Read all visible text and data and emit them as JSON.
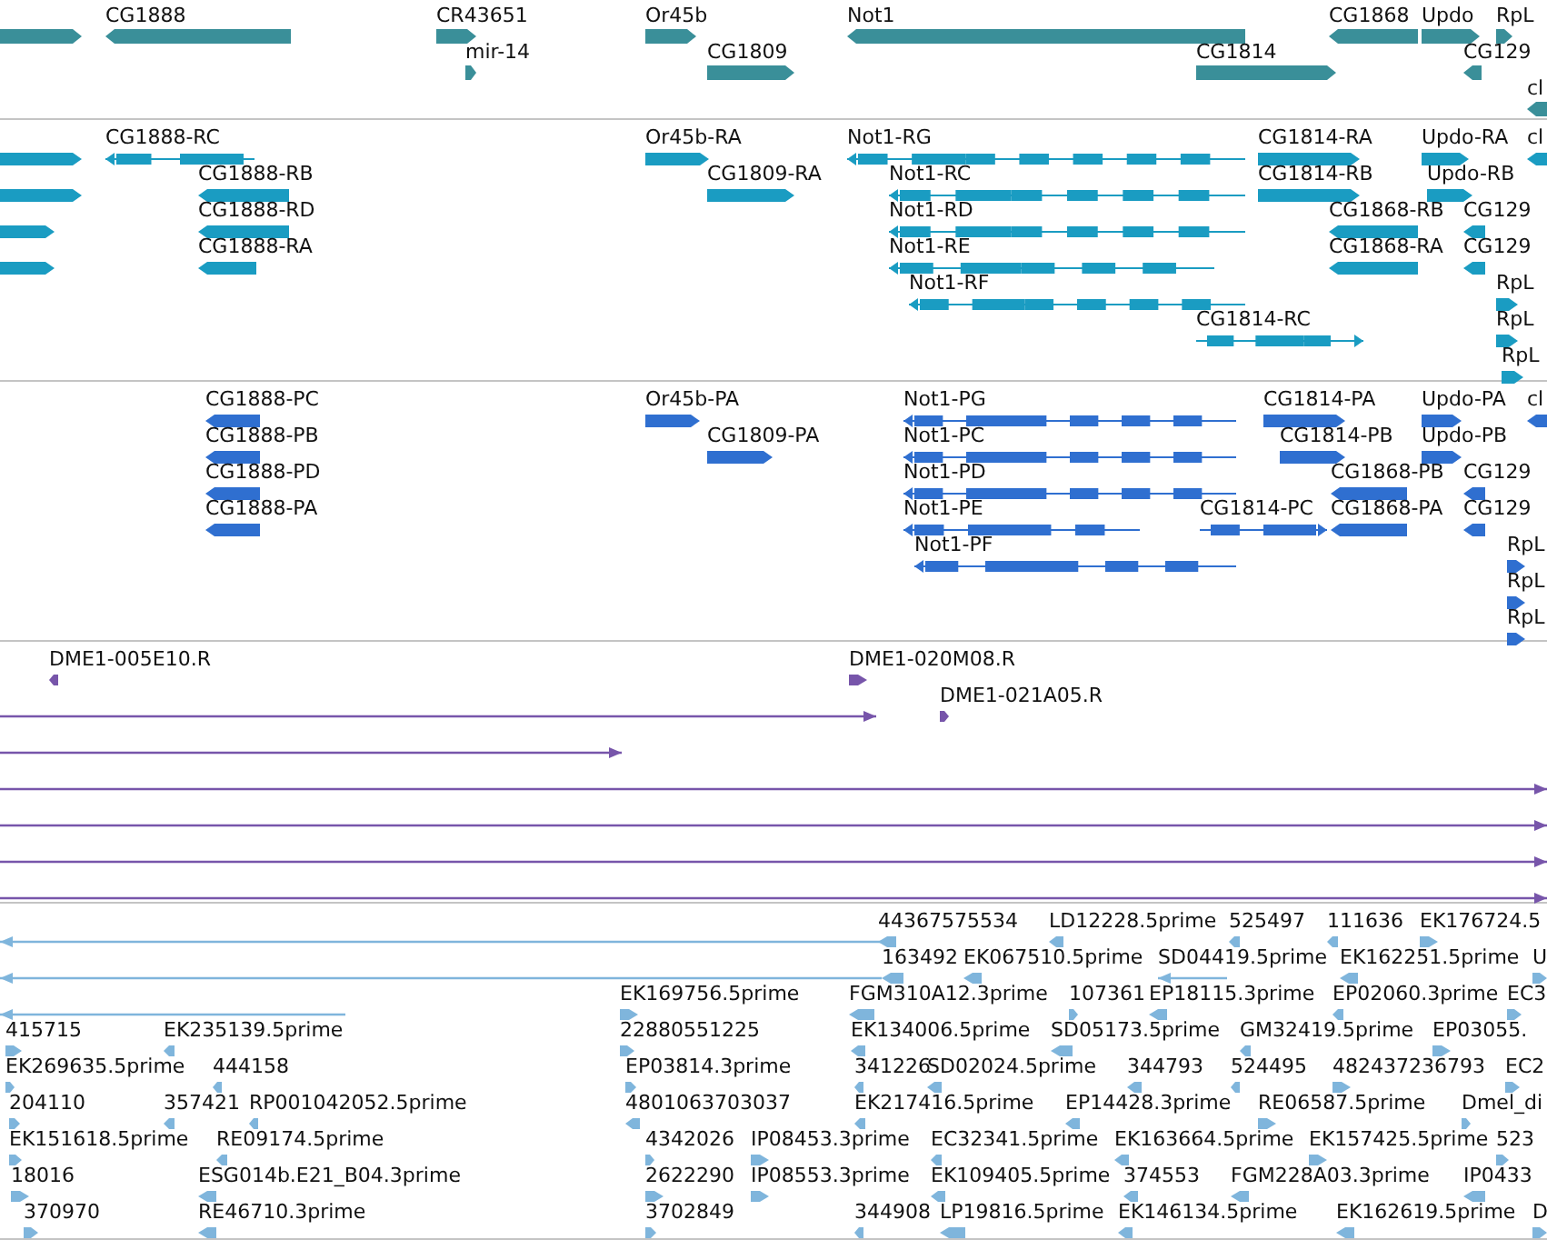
{
  "tracks": [
    {
      "kind": "gene",
      "color": "#3a8f99",
      "features": [
        {
          "reverse": false
        },
        {
          "label": "CG1888",
          "reverse": true
        },
        {
          "label": "CR43651",
          "reverse": false
        },
        {
          "label": "mir-14",
          "reverse": false
        },
        {
          "label": "Or45b",
          "reverse": false
        },
        {
          "label": "CG1809",
          "reverse": false
        },
        {
          "label": "Not1",
          "reverse": true
        },
        {
          "label": "CG1814",
          "reverse": false
        },
        {
          "label": "CG1868",
          "reverse": true
        },
        {
          "label": "Updo",
          "reverse": false
        },
        {
          "label": "RpL",
          "reverse": false
        },
        {
          "label": "CG129",
          "reverse": true
        },
        {
          "label": "cl",
          "reverse": true
        }
      ]
    },
    {
      "kind": "transcript",
      "color": "#1a9cc2",
      "features": [
        {
          "reverse": false
        },
        {
          "reverse": false
        },
        {
          "reverse": false
        },
        {
          "reverse": false
        },
        {
          "label": "CG1888-RC",
          "reverse": true
        },
        {
          "label": "CG1888-RB",
          "reverse": true
        },
        {
          "label": "CG1888-RD",
          "reverse": true
        },
        {
          "label": "CG1888-RA",
          "reverse": true
        },
        {
          "label": "Or45b-RA",
          "reverse": false
        },
        {
          "label": "CG1809-RA",
          "reverse": false
        },
        {
          "label": "Not1-RG",
          "reverse": true
        },
        {
          "label": "Not1-RC",
          "reverse": true
        },
        {
          "label": "Not1-RD",
          "reverse": true
        },
        {
          "label": "Not1-RE",
          "reverse": true
        },
        {
          "label": "Not1-RF",
          "reverse": true
        },
        {
          "label": "CG1814-RA",
          "reverse": false
        },
        {
          "label": "CG1814-RB",
          "reverse": false
        },
        {
          "label": "CG1868-RB",
          "reverse": true
        },
        {
          "label": "CG1868-RA",
          "reverse": true
        },
        {
          "label": "CG1814-RC",
          "reverse": false
        },
        {
          "label": "Updo-RA",
          "reverse": false
        },
        {
          "label": "Updo-RB",
          "reverse": false
        },
        {
          "label": "cl",
          "reverse": true
        },
        {
          "label": "CG129",
          "reverse": true
        },
        {
          "label": "CG129",
          "reverse": true
        },
        {
          "label": "RpL",
          "reverse": false
        },
        {
          "label": "RpL",
          "reverse": false
        },
        {
          "label": "RpL",
          "reverse": false
        }
      ]
    },
    {
      "kind": "protein",
      "color": "#2f6fd0",
      "features": [
        {
          "label": "CG1888-PC",
          "reverse": true
        },
        {
          "label": "CG1888-PB",
          "reverse": true
        },
        {
          "label": "CG1888-PD",
          "reverse": true
        },
        {
          "label": "CG1888-PA",
          "reverse": true
        },
        {
          "label": "Or45b-PA",
          "reverse": false
        },
        {
          "label": "CG1809-PA",
          "reverse": false
        },
        {
          "label": "Not1-PG",
          "reverse": true
        },
        {
          "label": "Not1-PC",
          "reverse": true
        },
        {
          "label": "Not1-PD",
          "reverse": true
        },
        {
          "label": "Not1-PE",
          "reverse": true
        },
        {
          "label": "Not1-PF",
          "reverse": true
        },
        {
          "label": "CG1814-PA",
          "reverse": false
        },
        {
          "label": "CG1814-PB",
          "reverse": false
        },
        {
          "label": "CG1868-PB",
          "reverse": true
        },
        {
          "label": "CG1814-PC",
          "reverse": false
        },
        {
          "label": "CG1868-PA",
          "reverse": true
        },
        {
          "label": "Updo-PA",
          "reverse": false
        },
        {
          "label": "Updo-PB",
          "reverse": false
        },
        {
          "label": "cl",
          "reverse": true
        },
        {
          "label": "CG129",
          "reverse": true
        },
        {
          "label": "CG129",
          "reverse": true
        },
        {
          "label": "RpL",
          "reverse": false
        },
        {
          "label": "RpL",
          "reverse": false
        },
        {
          "label": "RpL",
          "reverse": false
        }
      ]
    },
    {
      "kind": "read",
      "color": "#7755aa",
      "features": [
        {
          "label": "DME1-005E10.R",
          "reverse": true
        },
        {
          "label": "DME1-020M08.R",
          "reverse": false
        },
        {
          "label": "DME1-021A05.R",
          "reverse": false
        },
        {
          "reverse": false
        },
        {
          "reverse": false
        },
        {
          "reverse": false
        },
        {
          "reverse": false
        },
        {
          "reverse": false
        },
        {
          "reverse": false
        }
      ]
    },
    {
      "kind": "read",
      "color": "#7fb5dc",
      "features": [
        {
          "reverse": true
        },
        {
          "reverse": true
        },
        {
          "label": "44367575534",
          "reverse": true
        },
        {
          "label": "LD12228.5prime",
          "reverse": true
        },
        {
          "label": "525497",
          "reverse": true
        },
        {
          "label": "111636",
          "reverse": true
        },
        {
          "label": "EK176724.5",
          "reverse": false
        },
        {
          "label": "163492",
          "reverse": true
        },
        {
          "label": "EK067510.5prime",
          "reverse": true
        },
        {
          "label": "SD04419.5prime",
          "reverse": true
        },
        {
          "label": "EK162251.5prime",
          "reverse": true
        },
        {
          "label": "U",
          "reverse": false
        },
        {
          "reverse": true
        },
        {
          "label": "EK169756.5prime",
          "reverse": false
        },
        {
          "label": "FGM310A12.3prime",
          "reverse": true
        },
        {
          "label": "107361",
          "reverse": false
        },
        {
          "label": "EP18115.3prime",
          "reverse": true
        },
        {
          "label": "EP02060.3prime",
          "reverse": true
        },
        {
          "label": "EC3",
          "reverse": false
        },
        {
          "label": "415715",
          "reverse": false
        },
        {
          "label": "EK235139.5prime",
          "reverse": true
        },
        {
          "label": "22880551225",
          "reverse": false
        },
        {
          "label": "EK134006.5prime",
          "reverse": true
        },
        {
          "label": "SD05173.5prime",
          "reverse": true
        },
        {
          "label": "GM32419.5prime",
          "reverse": true
        },
        {
          "label": "EP03055.",
          "reverse": false
        },
        {
          "label": "EK269635.5prime",
          "reverse": false
        },
        {
          "label": "444158",
          "reverse": true
        },
        {
          "label": "EP03814.3prime",
          "reverse": false
        },
        {
          "label": "341226",
          "reverse": true
        },
        {
          "label": "SD02024.5prime",
          "reverse": true
        },
        {
          "label": "344793",
          "reverse": true
        },
        {
          "label": "524495",
          "reverse": true
        },
        {
          "label": "482437236793",
          "reverse": false
        },
        {
          "label": "EC2",
          "reverse": false
        },
        {
          "label": "204110",
          "reverse": false
        },
        {
          "label": "357421",
          "reverse": true
        },
        {
          "label": "RP001042052.5prime",
          "reverse": true
        },
        {
          "label": "4801063703037",
          "reverse": true
        },
        {
          "label": "EK217416.5prime",
          "reverse": true
        },
        {
          "label": "EP14428.3prime",
          "reverse": true
        },
        {
          "label": "RE06587.5prime",
          "reverse": false
        },
        {
          "label": "Dmel_di",
          "reverse": false
        },
        {
          "label": "EK151618.5prime",
          "reverse": false
        },
        {
          "label": "RE09174.5prime",
          "reverse": true
        },
        {
          "label": "4342026",
          "reverse": false
        },
        {
          "label": "IP08453.3prime",
          "reverse": false
        },
        {
          "label": "EC32341.5prime",
          "reverse": true
        },
        {
          "label": "EK163664.5prime",
          "reverse": true
        },
        {
          "label": "EK157425.5prime",
          "reverse": false
        },
        {
          "label": "523",
          "reverse": false
        },
        {
          "label": "18016",
          "reverse": false
        },
        {
          "label": "ESG014b.E21_B04.3prime",
          "reverse": true
        },
        {
          "label": "2622290",
          "reverse": false
        },
        {
          "label": "IP08553.3prime",
          "reverse": false
        },
        {
          "label": "EK109405.5prime",
          "reverse": true
        },
        {
          "label": "374553",
          "reverse": true
        },
        {
          "label": "FGM228A03.3prime",
          "reverse": true
        },
        {
          "label": "IP0433",
          "reverse": true
        },
        {
          "label": "370970",
          "reverse": false
        },
        {
          "label": "RE46710.3prime",
          "reverse": true
        },
        {
          "label": "3702849",
          "reverse": false
        },
        {
          "label": "344908",
          "reverse": true
        },
        {
          "label": "LP19816.5prime",
          "reverse": true
        },
        {
          "label": "EK146134.5prime",
          "reverse": true
        },
        {
          "label": "EK162619.5prime",
          "reverse": true
        },
        {
          "label": "D",
          "reverse": false
        }
      ]
    }
  ]
}
